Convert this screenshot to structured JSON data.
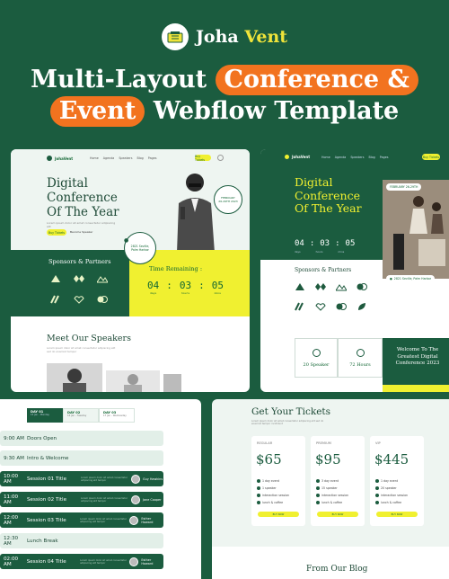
{
  "brand": {
    "name_a": "Joha",
    "name_b": "Vent"
  },
  "headline": {
    "line1_a": "Multi-Layout",
    "line1_pill": "Conference &",
    "line2_pill": "Event",
    "line2_b": "Webflow Template"
  },
  "preview1": {
    "logo": "JohaVent",
    "nav": [
      "Home",
      "Agenda",
      "Speakers",
      "Blog",
      "Pages"
    ],
    "buy_button": "Buy Tickets",
    "title": [
      "Digital",
      "Conference",
      "Of The Year"
    ],
    "subtitle": "Lorem ipsum dolor sit amet consectetur adipiscing elit",
    "btn_primary": "Buy Tickets",
    "btn_secondary": "Become Speaker",
    "date_badge": [
      "FEBRUARY",
      "26-29TH 2023"
    ],
    "location_badge": [
      "2821 Seville,",
      "Palm Harbor"
    ],
    "sponsors_title": "Sponsors & Partners",
    "time_title": "Time Remaining :",
    "countdown": [
      {
        "v": "04",
        "u": "days"
      },
      {
        "v": "03",
        "u": "hours"
      },
      {
        "v": "05",
        "u": "mins"
      }
    ],
    "speakers_title": "Meet Our Speakers",
    "speakers_sub": "Lorem ipsum dolor sit amet consectetur adipiscing elit sed do eiusmod tempor"
  },
  "preview2": {
    "logo": "JohaVent",
    "nav": [
      "Home",
      "Agenda",
      "Speakers",
      "Blog",
      "Pages"
    ],
    "buy_button": "Buy Tickets",
    "title": [
      "Digital",
      "Conference",
      "Of The Year"
    ],
    "countdown": [
      "04",
      "03",
      "05"
    ],
    "countdown_units": [
      "days",
      "hours",
      "mins"
    ],
    "date_badge": "FEBRUARY 26-29TH",
    "location_badge": "2821 Seville, Palm Harbor",
    "sponsors_title": "Sponsors & Partners",
    "stats": [
      {
        "label": "20 Speaker"
      },
      {
        "label": "72 Hours"
      }
    ],
    "welcome": "Welcome To The Greatest Digital Conference 2023"
  },
  "schedule": {
    "tabs": [
      {
        "day": "DAY 01",
        "date": "15 Jan - Monday"
      },
      {
        "day": "DAY 02",
        "date": "16 Jan - Tuesday"
      },
      {
        "day": "DAY 03",
        "date": "17 Jan - Wednesday"
      }
    ],
    "rows": [
      {
        "time": "9:00 AM",
        "label": "Doors Open",
        "dark": false
      },
      {
        "time": "9:30 AM",
        "label": "Intro & Welcome",
        "dark": false
      },
      {
        "time": "10:00 AM",
        "label": "Session 01 Title",
        "dark": true,
        "speaker": "Guy Hawkins"
      },
      {
        "time": "11:00 AM",
        "label": "Session 02 Title",
        "dark": true,
        "speaker": "Jane Cooper"
      },
      {
        "time": "12:00 AM",
        "label": "Session 03 Title",
        "dark": true,
        "speaker": "Esther Howard"
      },
      {
        "time": "12:30 AM",
        "label": "Lunch Break",
        "dark": false
      },
      {
        "time": "02:00 AM",
        "label": "Session 04 Title",
        "dark": true,
        "speaker": "Esther Howard"
      }
    ],
    "row_desc": "Lorem ipsum dolor sit amet consectetur adipiscing elit tempor"
  },
  "tickets": {
    "title": "Get Your Tickets",
    "subtitle": "Lorem ipsum dolor sit amet consectetur adipiscing elit sed do eiusmod tempor incididunt",
    "plans": [
      {
        "name": "REGULAR",
        "price": "$65",
        "features": [
          "1 day event",
          "1 speaker",
          "interaction session",
          "lunch & coffee"
        ],
        "button": "BUY NOW"
      },
      {
        "name": "PREMIUM",
        "price": "$95",
        "features": [
          "3 day event",
          "15 speaker",
          "interaction session",
          "lunch & coffee"
        ],
        "button": "BUY NOW"
      },
      {
        "name": "VIP",
        "price": "$445",
        "features": [
          "1 day event",
          "20 speaker",
          "interaction session",
          "lunch & coffee"
        ],
        "button": "BUY NOW"
      }
    ],
    "blog_title": "From Our Blog"
  },
  "colors": {
    "green": "#1b5c3f",
    "orange": "#f2731f",
    "yellow": "#f0f030"
  }
}
